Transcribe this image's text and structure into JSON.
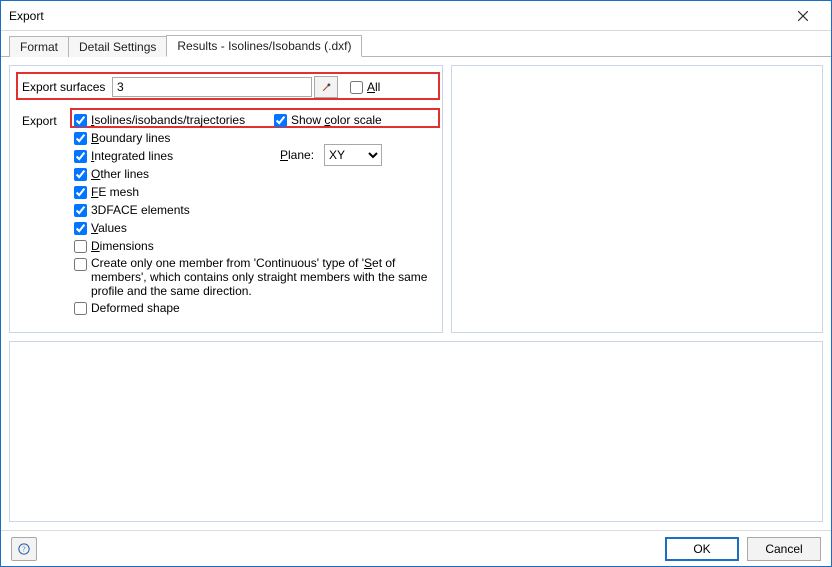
{
  "window": {
    "title": "Export"
  },
  "tabs": {
    "format": "Format",
    "detail": "Detail Settings",
    "results": "Results - Isolines/Isobands (.dxf)"
  },
  "surfaces": {
    "label": "Export surfaces",
    "value": "3",
    "all_label_pre": "",
    "all_u": "A",
    "all_rest": "ll"
  },
  "export_label": "Export",
  "opts": {
    "iso_u": "I",
    "iso_rest": "solines/isobands/trajectories",
    "scs_pre": "Show ",
    "scs_u": "c",
    "scs_rest": "olor scale",
    "bl_u": "B",
    "bl_rest": "oundary lines",
    "il_u": "I",
    "il_rest": "ntegrated lines",
    "ol_u": "O",
    "ol_rest": "ther lines",
    "fe_u": "F",
    "fe_rest": "E mesh",
    "df_rest": "3DFACE elements",
    "val_u": "V",
    "val_rest": "alues",
    "dim_u": "D",
    "dim_rest": "imensions",
    "cont_pre": "Create only one member from 'Continuous' type of '",
    "cont_u": "S",
    "cont_rest": "et of members', which contains only straight members with the same profile and the same direction.",
    "defshape_rest": "Deformed shape"
  },
  "plane": {
    "label_u": "P",
    "label_rest": "lane:",
    "value": "XY"
  },
  "footer": {
    "ok": "OK",
    "cancel": "Cancel"
  }
}
